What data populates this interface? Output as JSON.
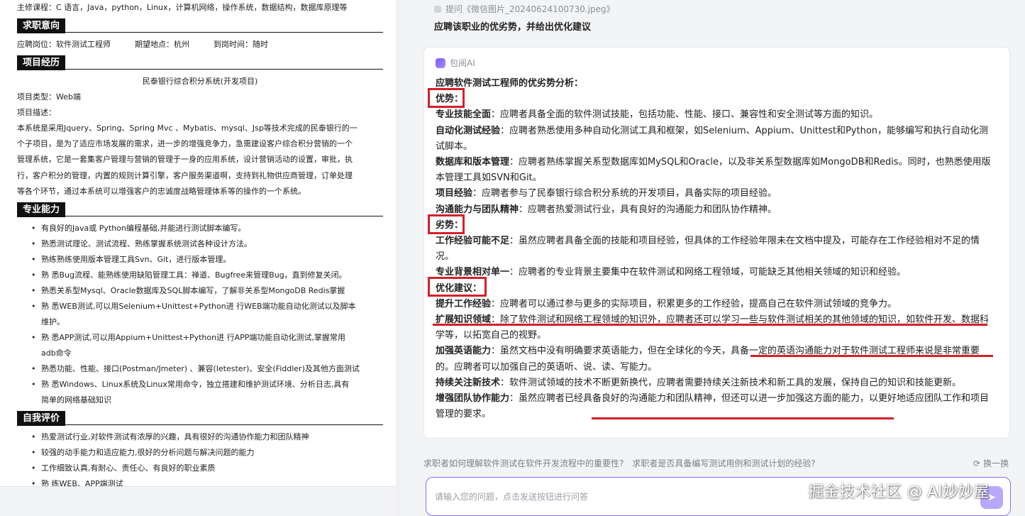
{
  "resume": {
    "main_courses": "主修课程：C 语言，Java，python，Linux，计算机网络，操作系统，数据结构，数据库原理等",
    "sec_intent": "求职意向",
    "intent_position": "应聘岗位：软件测试工程师",
    "intent_location": "期望地点：杭州",
    "intent_time": "到岗时间：随时",
    "sec_project": "项目经历",
    "project_title": "民泰银行综合积分系统(开发项目)",
    "project_type": "项目类型：Web端",
    "project_desc_label": "项目描述：",
    "project_desc_lines": [
      "本系统是采用Jquery、Spring、Spring Mvc 、Mybatis、mysql、Jsp等技术完成的民泰银行的一",
      "个子项目，是为了适应市场发展的需求，进一步的增强竞争力，急需建设客户综合积分营销的一个",
      "管理系统，它是一套集客户管理与营销的管理于一身的应用系统，设计营销活动的设置，审批，执",
      "行，客户积分的管理，内置的规则计算引擎，客户服务渠道啊，支持到礼物供应商管理，订单处理",
      "等各个环节，通过本系统可以增强客户的忠诚度战略管理体系等的操作的一个系统。"
    ],
    "sec_skills": "专业能力",
    "skills": [
      "有良好的Java或 Python编程基础,并能进行测试脚本编写。",
      "熟悉测试理论、测试流程、熟练掌握系统测试各种设计方法。",
      "熟练熟练使用版本管理工具Svn、Git，进行版本管理。",
      "熟 悉Bug流程、能熟练使用缺陷管理工具：禅道、Bugfree来管理Bug，直到修复关闭。",
      "熟悉关系型Mysql、Oracle数据库及SQL脚本编写，了解非关系型MongoDB Redis掌握",
      "熟 悉WEB测试,可以用Selenium+Unittest+Python进 行WEB端功能自动化测试以及脚本",
      "维护。",
      "熟 悉APP测试,可以用Appium+Unittest+Python进 行APP端功能自动化测试,掌握常用",
      "adb命令",
      "熟悉功能、性能、接口(Postman/Jmeter) 、兼容(letester)、安全(Fiddler)及其他方面测试",
      "熟 悉Windows、Linux系统及Linux常用命令，独立搭建和维护测试环境、分析日志,具有",
      "简单的网络基础知识"
    ],
    "sec_self": "自我评价",
    "self_eval": [
      "热爱测试行业,对软件测试有浓厚的兴趣，具有很好的沟通协作能力和团队精神",
      "较强的动手能力和适应能力,很好的分析问题与解决问题的能力",
      "工作细致认真,有耐心、责任心、有良好的职业素质",
      "熟 练WEB、APP端测试"
    ]
  },
  "chat": {
    "question_ref": "提问《微信图片_20240624100730.jpeg》",
    "question": "应聘该职业的优劣势，并给出优化建议",
    "ai_name": "包阅AI",
    "title": "应聘软件测试工程师的优劣势分析：",
    "adv_head": "优势：",
    "adv": [
      {
        "k": "专业技能全面",
        "v": "：应聘者具备全面的软件测试技能，包括功能、性能、接口、兼容性和安全测试等方面的知识。"
      },
      {
        "k": "自动化测试经验",
        "v": "：应聘者熟悉使用多种自动化测试工具和框架，如Selenium、Appium、Unittest和Python，能够编写和执行自动化测试脚本。"
      },
      {
        "k": "数据库和版本管理",
        "v": "：应聘者熟练掌握关系型数据库如MySQL和Oracle，以及非关系型数据库如MongoDB和Redis。同时，也熟悉使用版本管理工具如SVN和Git。"
      },
      {
        "k": "项目经验",
        "v": "：应聘者参与了民泰银行综合积分系统的开发项目，具备实际的项目经验。"
      },
      {
        "k": "沟通能力与团队精神",
        "v": "：应聘者热爱测试行业，具有良好的沟通能力和团队协作精神。"
      }
    ],
    "dis_head": "劣势：",
    "dis": [
      {
        "k": "工作经验可能不足",
        "v": "：虽然应聘者具备全面的技能和项目经验，但具体的工作经验年限未在文档中提及，可能存在工作经验相对不足的情况。"
      },
      {
        "k": "专业背景相对单一",
        "v": "：应聘者的专业背景主要集中在软件测试和网络工程领域，可能缺乏其他相关领域的知识和经验。"
      }
    ],
    "opt_head": "优化建议：",
    "opt": [
      {
        "k": "提升工作经验",
        "v": "：应聘者可以通过参与更多的实际项目，积累更多的工作经验，提高自己在软件测试领域的竞争力。"
      },
      {
        "k": "扩展知识领域",
        "v": "：除了软件测试和网络工程领域的知识外，应聘者还可以学习一些与软件测试相关的其他领域的知识，如软件开发、数据科学等，以拓宽自己的视野。"
      },
      {
        "k": "加强英语能力",
        "v": "：虽然文档中没有明确要求英语能力，但在全球化的今天，具备一定的英语沟通能力对于软件测试工程师来说是非常重要的。应聘者可以加强自己的英语听、说、读、写能力。"
      },
      {
        "k": "持续关注新技术",
        "v": "：软件测试领域的技术不断更新换代，应聘者需要持续关注新技术和新工具的发展，保持自己的知识和技能更新。"
      },
      {
        "k": "增强团队协作能力",
        "v": "：虽然应聘者已经具备良好的沟通能力和团队精神，但还可以进一步加强这方面的能力，以更好地适应团队工作和项目管理的要求。"
      }
    ],
    "suggestions": [
      "求职者如何理解软件测试在软件开发流程中的重要性?",
      "求职者是否具备编写测试用例和测试计划的经验?"
    ],
    "refresh_label": "换一换",
    "input_placeholder": "请输入您的问题，点击发送按钮进行问答",
    "watermark": "掘金技术社区 @ AI妙妙屋"
  },
  "colors": {
    "accent": "#8b6cf6",
    "annotation_red": "#d3202b"
  }
}
